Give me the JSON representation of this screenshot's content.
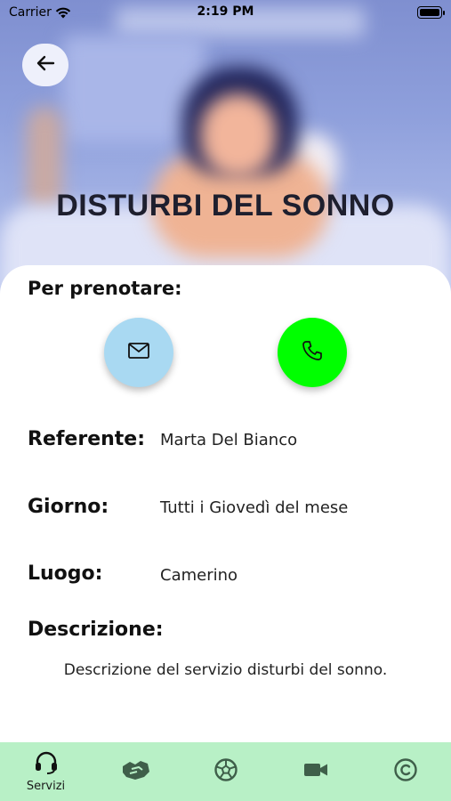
{
  "status_bar": {
    "carrier": "Carrier",
    "time": "2:19 PM"
  },
  "header": {
    "title": "DISTURBI DEL SONNO"
  },
  "booking": {
    "label": "Per prenotare:"
  },
  "details": [
    {
      "label": "Referente:",
      "value": "Marta Del Bianco"
    },
    {
      "label": "Giorno:",
      "value": "Tutti i Giovedì del mese"
    },
    {
      "label": "Luogo:",
      "value": "Camerino"
    }
  ],
  "description": {
    "label": "Descrizione:",
    "text": "Descrizione del servizio disturbi del sonno."
  },
  "tabbar": {
    "items": [
      {
        "icon": "headset-icon",
        "label": "Servizi",
        "active": true
      },
      {
        "icon": "handshake-icon",
        "label": ""
      },
      {
        "icon": "soccer-ball-icon",
        "label": ""
      },
      {
        "icon": "video-camera-icon",
        "label": ""
      },
      {
        "icon": "copyright-icon",
        "label": ""
      }
    ]
  },
  "colors": {
    "tabbar_bg": "#b8f0c6",
    "mail_button": "#a9d9f2",
    "phone_button": "#00ff00"
  }
}
